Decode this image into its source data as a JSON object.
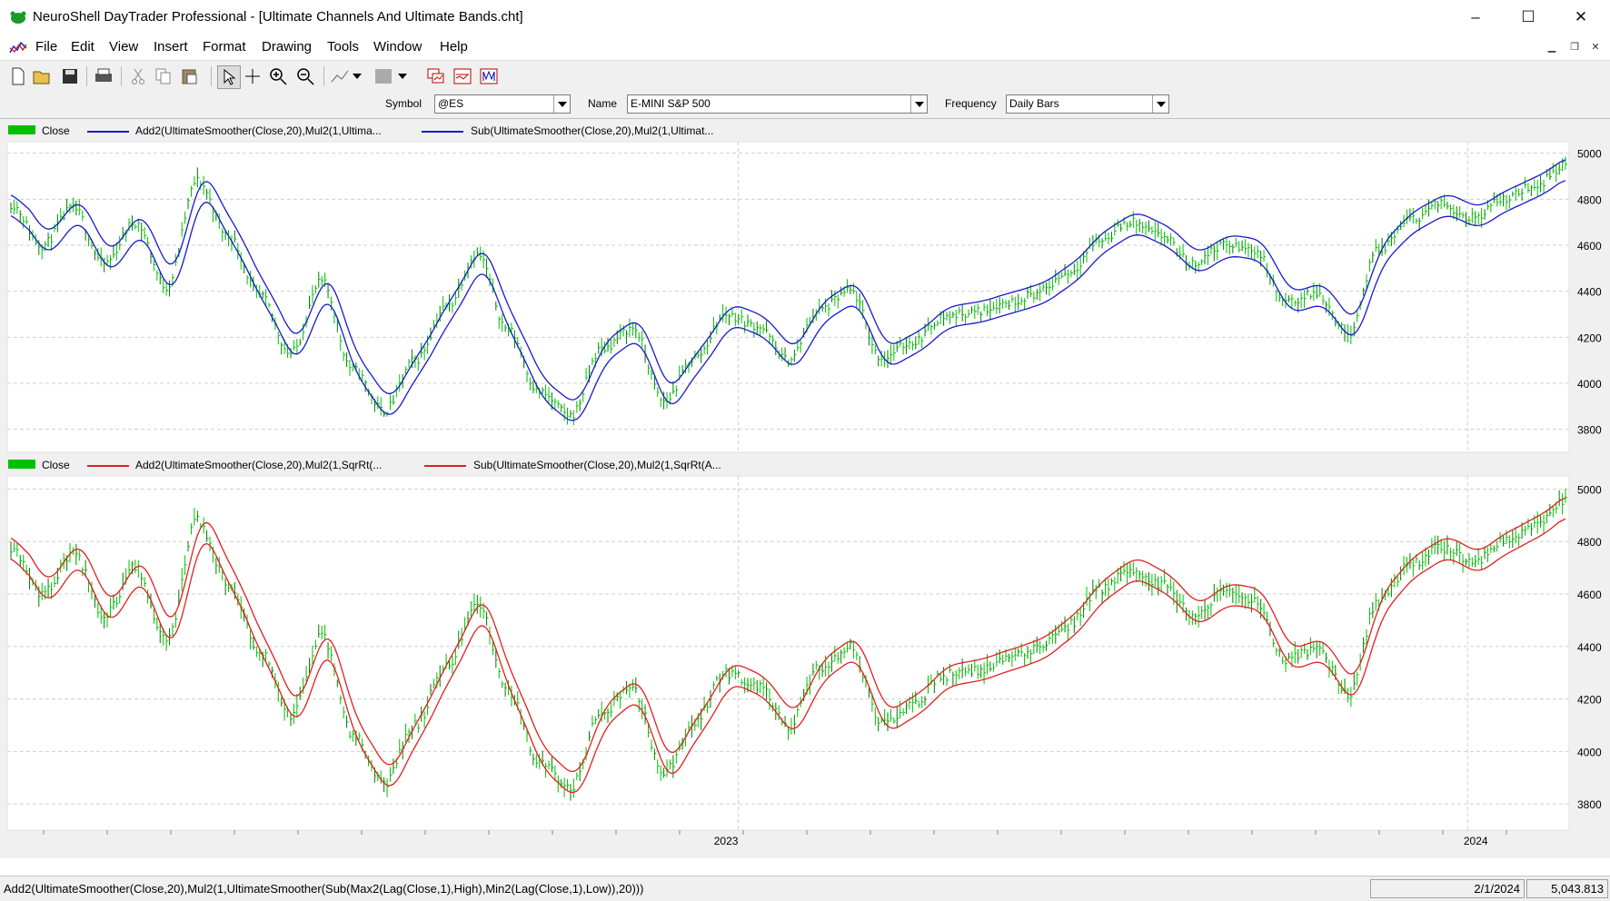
{
  "window": {
    "title": "NeuroShell DayTrader Professional - [Ultimate Channels And Ultimate Bands.cht]",
    "controls": [
      "–",
      "☐",
      "✕"
    ]
  },
  "menu": [
    "File",
    "Edit",
    "View",
    "Insert",
    "Format",
    "Drawing",
    "Tools",
    "Window",
    "Help"
  ],
  "toolbar": {
    "icons": [
      "new-file-icon",
      "open-folder-icon",
      "save-icon",
      "print-icon",
      "cut-icon",
      "copy-icon",
      "paste-icon",
      "pointer-icon",
      "crosshair-icon",
      "zoom-in-icon",
      "zoom-out-icon",
      "draw-line-icon",
      "dropdown-icon",
      "pattern-icon",
      "dropdown-icon",
      "chart-window-icon",
      "chart-page-icon",
      "indicator-icon"
    ]
  },
  "symbolbar": {
    "symbol_label": "Symbol",
    "symbol_value": "@ES",
    "name_label": "Name",
    "name_value": "E-MINI S&P 500",
    "frequency_label": "Frequency",
    "frequency_value": "Daily Bars"
  },
  "panes": [
    {
      "legend": [
        {
          "label": "Close",
          "kind": "bar"
        },
        {
          "label": "Add2(UltimateSmoother(Close,20),Mul2(1,Ultima...",
          "kind": "line"
        },
        {
          "label": "Sub(UltimateSmoother(Close,20),Mul2(1,Ultimat...",
          "kind": "line"
        }
      ],
      "band_color": "#1a1acc"
    },
    {
      "legend": [
        {
          "label": "Close",
          "kind": "bar"
        },
        {
          "label": "Add2(UltimateSmoother(Close,20),Mul2(1,SqrRt(...",
          "kind": "line"
        },
        {
          "label": "Sub(UltimateSmoother(Close,20),Mul2(1,SqrRt(A...",
          "kind": "line"
        }
      ],
      "band_color": "#e02020"
    }
  ],
  "colors": {
    "bars": "#00c000",
    "bars_dark": "#007a00"
  },
  "chart_data": [
    {
      "type": "line",
      "description_pane": "Ultimate Channels",
      "x": [
        0,
        10,
        20,
        30,
        40,
        50,
        60,
        70,
        80,
        90,
        100,
        110,
        120,
        130,
        140,
        150,
        160,
        170,
        180,
        190,
        200,
        210,
        220,
        230,
        240,
        250,
        260,
        270,
        280,
        290,
        300,
        310,
        320,
        330,
        340,
        350,
        360,
        370,
        380,
        390,
        400,
        410,
        420,
        430,
        440,
        450,
        460,
        470,
        480,
        490,
        500
      ],
      "series": [
        {
          "name": "Close",
          "values": [
            4780,
            4600,
            4760,
            4520,
            4700,
            4420,
            4880,
            4640,
            4380,
            4130,
            4440,
            4060,
            3880,
            4100,
            4330,
            4560,
            4230,
            3960,
            3860,
            4150,
            4240,
            3920,
            4110,
            4300,
            4250,
            4100,
            4320,
            4400,
            4110,
            4180,
            4290,
            4310,
            4350,
            4390,
            4480,
            4620,
            4700,
            4640,
            4520,
            4600,
            4580,
            4350,
            4390,
            4220,
            4580,
            4710,
            4780,
            4720,
            4800,
            4860,
            4950
          ]
        }
      ],
      "ylim": [
        3700,
        5050
      ],
      "yticks": [
        3800,
        4000,
        4200,
        4400,
        4600,
        4800,
        5000
      ]
    },
    {
      "type": "line",
      "description_pane": "Ultimate Bands",
      "x": [
        0,
        10,
        20,
        30,
        40,
        50,
        60,
        70,
        80,
        90,
        100,
        110,
        120,
        130,
        140,
        150,
        160,
        170,
        180,
        190,
        200,
        210,
        220,
        230,
        240,
        250,
        260,
        270,
        280,
        290,
        300,
        310,
        320,
        330,
        340,
        350,
        360,
        370,
        380,
        390,
        400,
        410,
        420,
        430,
        440,
        450,
        460,
        470,
        480,
        490,
        500
      ],
      "series": [
        {
          "name": "Close",
          "values": [
            4780,
            4600,
            4760,
            4520,
            4700,
            4420,
            4880,
            4640,
            4380,
            4130,
            4440,
            4060,
            3880,
            4100,
            4330,
            4560,
            4230,
            3960,
            3860,
            4150,
            4240,
            3920,
            4110,
            4300,
            4250,
            4100,
            4320,
            4400,
            4110,
            4180,
            4290,
            4310,
            4350,
            4390,
            4480,
            4620,
            4700,
            4640,
            4520,
            4600,
            4580,
            4350,
            4390,
            4220,
            4580,
            4710,
            4780,
            4720,
            4800,
            4860,
            4950
          ]
        }
      ],
      "ylim": [
        3700,
        5050
      ],
      "yticks": [
        3800,
        4000,
        4200,
        4400,
        4600,
        4800,
        5000
      ],
      "xticks": [
        "2023",
        "2024"
      ]
    }
  ],
  "status": {
    "formula": "Add2(UltimateSmoother(Close,20),Mul2(1,UltimateSmoother(Sub(Max2(Lag(Close,1),High),Min2(Lag(Close,1),Low)),20)))",
    "date": "2/1/2024",
    "value": "5,043.813"
  }
}
